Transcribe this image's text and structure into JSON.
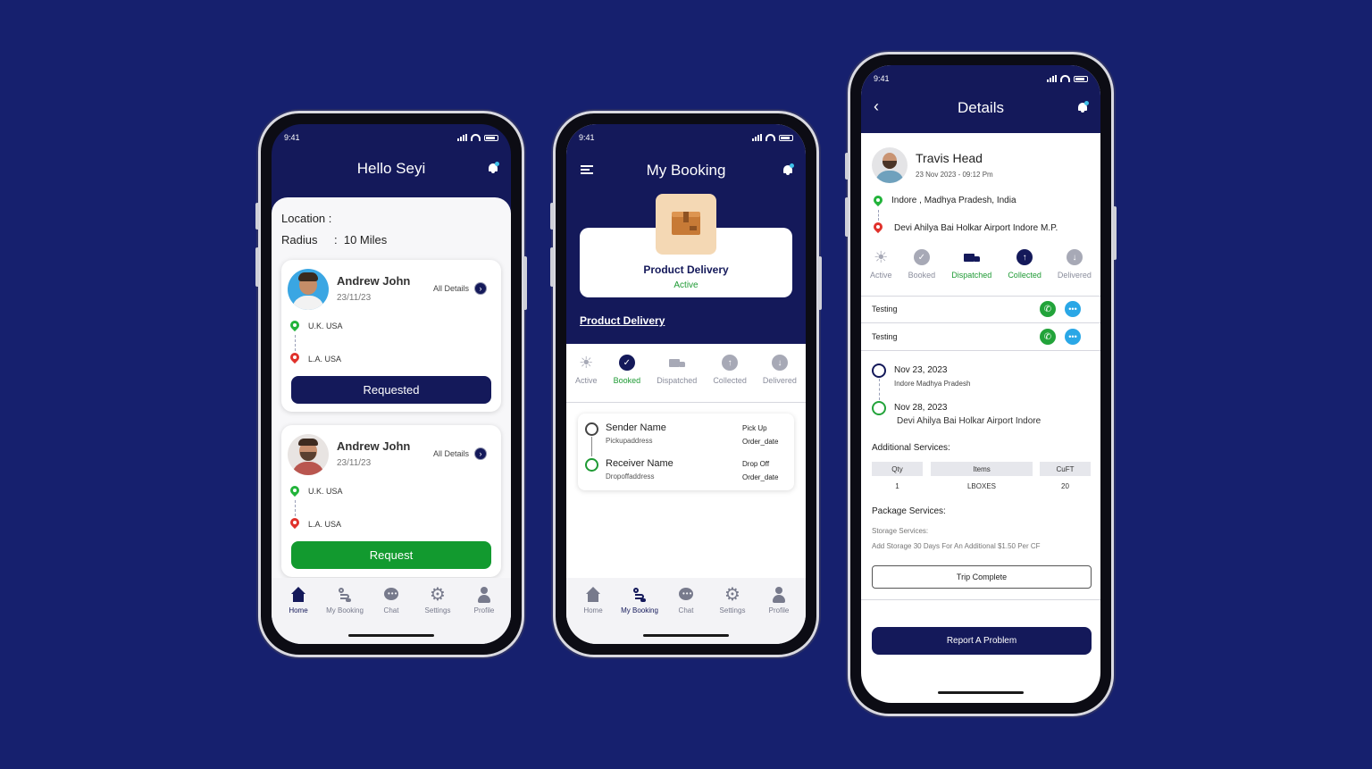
{
  "colors": {
    "navy": "#14195a",
    "background": "#16206e",
    "green": "#1e9a34",
    "active_green": "#21a03a",
    "accent": "#3fc1e8"
  },
  "status_time": "9:41",
  "home": {
    "title": "Hello Seyi",
    "location_label": "Location :",
    "radius_label": "Radius",
    "radius_value": ":  10 Miles",
    "cards": [
      {
        "name": "Andrew John",
        "date": "23/11/23",
        "details": "All Details",
        "from": "U.K. USA",
        "to": "L.A. USA",
        "button": "Requested",
        "button_color": "#14195a"
      },
      {
        "name": "Andrew John",
        "date": "23/11/23",
        "details": "All Details",
        "from": "U.K. USA",
        "to": "L.A. USA",
        "button": "Request",
        "button_color": "#129a2f"
      }
    ]
  },
  "nav": {
    "home": "Home",
    "booking": "My Booking",
    "chat": "Chat",
    "settings": "Settings",
    "profile": "Profile"
  },
  "booking": {
    "title": "My Booking",
    "product_title": "Product Delivery",
    "product_status": "Active",
    "link": "Product Delivery",
    "steps": [
      "Active",
      "Booked",
      "Dispatched",
      "Collected",
      "Delivered"
    ],
    "sender_name": "Sender Name",
    "sender_addr": "Pickupaddress",
    "pickup": "Pick Up",
    "pickup_date": "Order_date",
    "receiver_name": "Receiver Name",
    "receiver_addr": "Dropoffaddress",
    "dropoff": "Drop Off",
    "dropoff_date": "Order_date"
  },
  "details": {
    "title": "Details",
    "name": "Travis Head",
    "datetime": "23 Nov 2023 - 09:12 Pm",
    "from": "Indore , Madhya Pradesh, India",
    "to": "Devi Ahilya Bai Holkar Airport Indore M.P.",
    "steps": [
      "Active",
      "Booked",
      "Dispatched",
      "Collected",
      "Delivered"
    ],
    "contacts": [
      "Testing",
      "Testing"
    ],
    "t1_date": "Nov 23, 2023",
    "t1_place": "Indore Madhya Pradesh",
    "t2_date": "Nov 28, 2023",
    "t2_place": "Devi Ahilya Bai Holkar Airport Indore",
    "additional_label": "Additional Services:",
    "table_headers": [
      "Qty",
      "Items",
      "CuFT"
    ],
    "table_row": [
      "1",
      "LBOXES",
      "20"
    ],
    "package_label": "Package Services:",
    "storage_label": "Storage Services:",
    "storage_text": "Add Storage 30 Days For An Additional $1.50 Per CF",
    "trip_button": "Trip Complete",
    "report_button": "Report A Problem"
  }
}
